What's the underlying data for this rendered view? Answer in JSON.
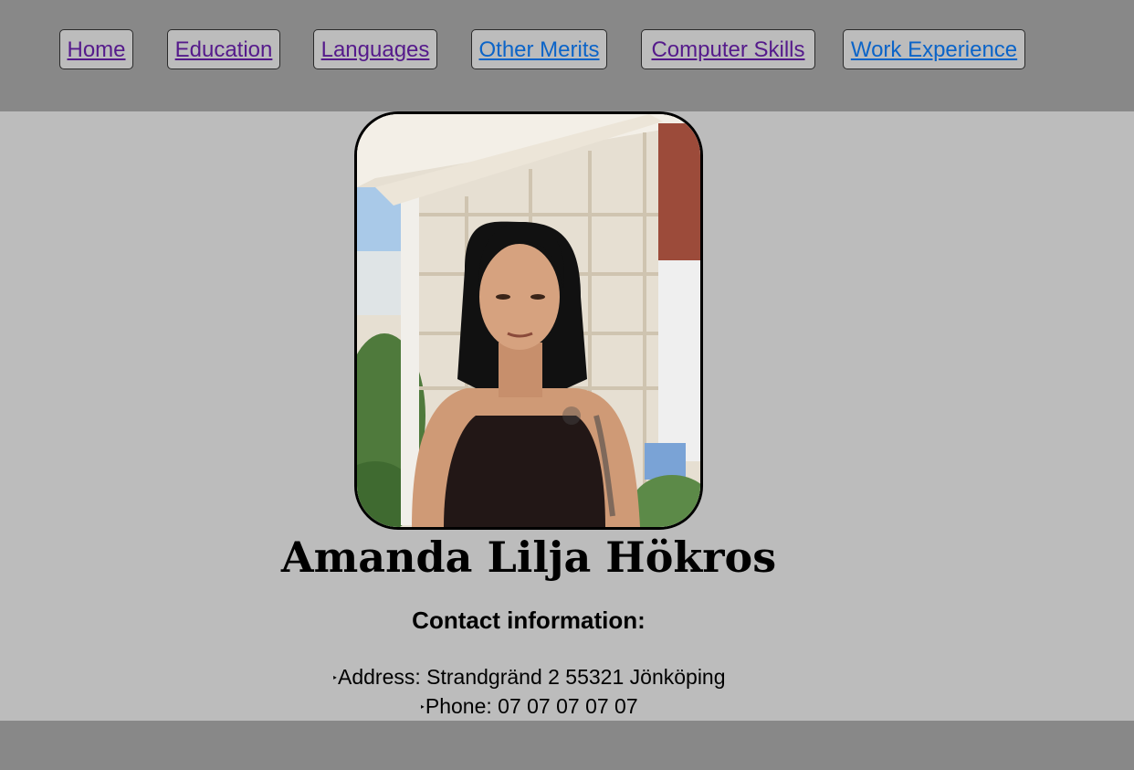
{
  "nav": {
    "items": [
      {
        "label": "Home",
        "state": "visited"
      },
      {
        "label": "Education",
        "state": "visited"
      },
      {
        "label": "Languages",
        "state": "visited"
      },
      {
        "label": "Other Merits",
        "state": "unvisited"
      },
      {
        "label": "Computer Skills",
        "state": "visited"
      },
      {
        "label": "Work Experience",
        "state": "unvisited"
      }
    ]
  },
  "profile": {
    "name": "Amanda Lilja Hökros",
    "contact_heading": "Contact information:",
    "contact": [
      {
        "bullet": "‣",
        "text": "Address: Strandgränd 2 55321 Jönköping"
      },
      {
        "bullet": "‣",
        "text": "Phone: 07 07 07 07 07"
      }
    ]
  },
  "colors": {
    "header_bg": "#888888",
    "body_bg": "#bcbcbc",
    "link_visited": "#551a8b",
    "link_unvisited": "#0b64c8"
  }
}
